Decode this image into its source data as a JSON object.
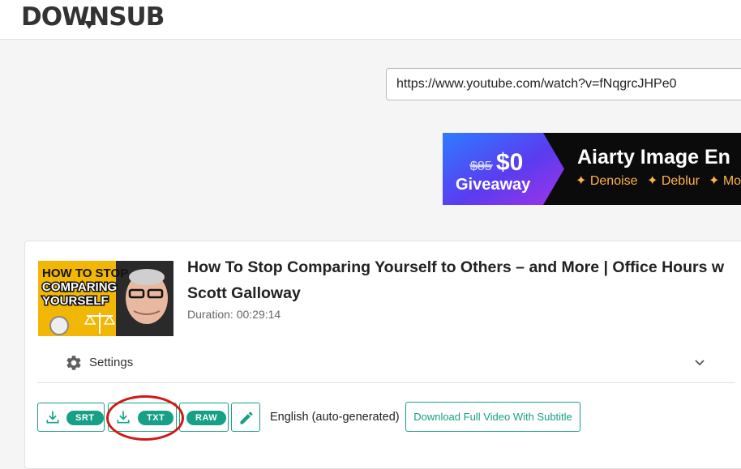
{
  "header": {
    "logo_text": "DOWNSUB"
  },
  "search": {
    "url_value": "https://www.youtube.com/watch?v=fNqgrcJHPe0"
  },
  "ad": {
    "old_price": "$85",
    "new_price": "$0",
    "giveaway": "Giveaway",
    "headline": "Aiarty Image En",
    "features": [
      "✦ Denoise",
      "✦ Deblur",
      "✦ Mo"
    ]
  },
  "video": {
    "thumbnail_text": [
      "HOW TO STOP",
      "COMPARING",
      "YOURSELF"
    ],
    "title": "How To Stop Comparing Yourself to Others – and More | Office Hours w Scott Galloway",
    "duration": "Duration: 00:29:14"
  },
  "settings": {
    "label": "Settings"
  },
  "downloads": {
    "srt": "SRT",
    "txt": "TXT",
    "raw": "RAW",
    "language": "English (auto-generated)",
    "full_video": "Download Full Video With Subtitle"
  },
  "colors": {
    "accent": "#16a085",
    "annotation": "#d01818"
  }
}
